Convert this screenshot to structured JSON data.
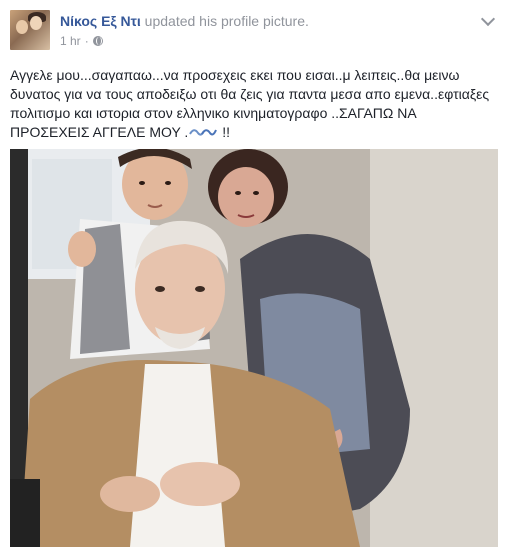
{
  "post": {
    "author": "Νίκος Εξ Ντι",
    "action": "updated his profile picture.",
    "timestamp": "1 hr",
    "separator": "·",
    "text": "Αγγελε μου...σαγαπαω...να προσεχεις εκει που εισαι..μ λειπεις..θα μεινω δυνατος για να τους αποδειξω οτι θα ζεις για παντα μεσα απο εμενα..εφτιαξες πολιτισμο και ιστορια στον ελληνικο κινηματογραφο ..ΣΑΓΑΠΩ ΝΑ ΠΡΟΣΕΧΕΙΣ ΑΓΓΕΛΕ ΜΟΥ .",
    "text_end": "!!"
  },
  "icons": {
    "audience": "globe-icon",
    "menu": "chevron-down-icon",
    "emoji": "wave-icon"
  },
  "colors": {
    "link": "#365899",
    "secondary_text": "#90949c",
    "body_text": "#1d2129"
  }
}
